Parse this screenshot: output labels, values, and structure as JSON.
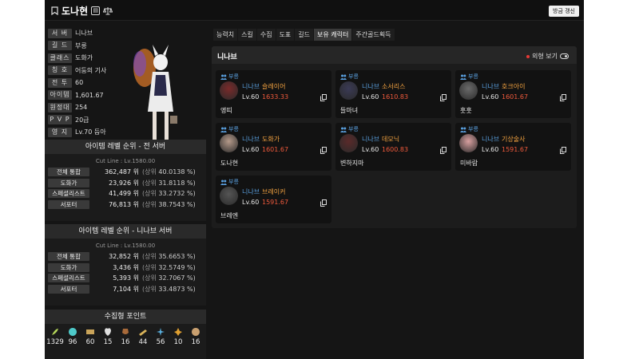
{
  "header": {
    "name": "도나현",
    "refresh_label": "방금 갱신"
  },
  "profile": {
    "rows": [
      {
        "key": "서 버",
        "value": "니나브"
      },
      {
        "key": "길 드",
        "value": "부릉"
      },
      {
        "key": "클래스",
        "value": "도화가"
      },
      {
        "key": "칭 호",
        "value": "어둠의 기사"
      },
      {
        "key": "전 투",
        "value": "60"
      },
      {
        "key": "아이템",
        "value": "1,601.67"
      },
      {
        "key": "원정대",
        "value": "254"
      },
      {
        "key": "P V P",
        "value": "20급"
      },
      {
        "key": "영 지",
        "value": "Lv.70 듬아"
      }
    ]
  },
  "rank_all": {
    "title": "아이템 레벨 순위 - 전 서버",
    "cutline": "Cut Line : Lv.1580.00",
    "rows": [
      {
        "key": "전체 통합",
        "value": "362,487 위",
        "paren_open": "(상위",
        "pct": "40.0138 %)"
      },
      {
        "key": "도화가",
        "value": "23,926 위",
        "paren_open": "(상위",
        "pct": "31.8118 %)"
      },
      {
        "key": "스페셜리스트",
        "value": "41,499 위",
        "paren_open": "(상위",
        "pct": "33.2732 %)"
      },
      {
        "key": "서포터",
        "value": "76,813 위",
        "paren_open": "(상위",
        "pct": "38.7543 %)"
      }
    ]
  },
  "rank_server": {
    "title": "아이템 레벨 순위 - 니나브 서버",
    "cutline": "Cut Line : Lv.1580.00",
    "rows": [
      {
        "key": "전체 통합",
        "value": "32,852 위",
        "paren_open": "(상위",
        "pct": "35.6653 %)"
      },
      {
        "key": "도화가",
        "value": "3,436 위",
        "paren_open": "(상위",
        "pct": "32.5749 %)"
      },
      {
        "key": "스페셜리스트",
        "value": "5,393 위",
        "paren_open": "(상위",
        "pct": "32.7067 %)"
      },
      {
        "key": "서포터",
        "value": "7,104 위",
        "paren_open": "(상위",
        "pct": "33.4873 %)"
      }
    ]
  },
  "collection": {
    "title": "수집형 포인트",
    "items": [
      {
        "icon": "seed-icon",
        "value": "1329",
        "color": "#b5d65a"
      },
      {
        "icon": "island-heart-icon",
        "value": "96",
        "color": "#4ec9c9"
      },
      {
        "icon": "artwork-icon",
        "value": "60",
        "color": "#c9a45a"
      },
      {
        "icon": "giant-heart-icon",
        "value": "15",
        "color": "#e0e0e0"
      },
      {
        "icon": "mokoko-icon",
        "value": "16",
        "color": "#a86a3a"
      },
      {
        "icon": "voyage-icon",
        "value": "44",
        "color": "#d9b35a"
      },
      {
        "icon": "world-tree-leaf-icon",
        "value": "56",
        "color": "#5ab0e0"
      },
      {
        "icon": "ignea-icon",
        "value": "10",
        "color": "#e0a030"
      },
      {
        "icon": "orpheus-star-icon",
        "value": "16",
        "color": "#c9a070"
      }
    ]
  },
  "tabs": [
    {
      "label": "능력치",
      "active": false
    },
    {
      "label": "스킬",
      "active": false
    },
    {
      "label": "수집",
      "active": false
    },
    {
      "label": "도표",
      "active": false
    },
    {
      "label": "길드",
      "active": false
    },
    {
      "label": "보유 캐릭터",
      "active": true
    },
    {
      "label": "주간골드획득",
      "active": false
    }
  ],
  "characters_panel": {
    "server": "니나브",
    "skin_toggle_label": "외형 보기",
    "cards": [
      {
        "role": "부릉",
        "server": "니나브",
        "class": "슬레이어",
        "level": "Lv.60",
        "item_level": "1633.33",
        "name": "앵띠",
        "avatar_color": "#7a2a2a"
      },
      {
        "role": "부릉",
        "server": "니나브",
        "class": "소서리스",
        "level": "Lv.60",
        "item_level": "1610.83",
        "name": "들마녀",
        "avatar_color": "#3a3a55"
      },
      {
        "role": "부릉",
        "server": "니나브",
        "class": "호크아이",
        "level": "Lv.60",
        "item_level": "1601.67",
        "name": "훗훗",
        "avatar_color": "#6a6a6a"
      },
      {
        "role": "부릉",
        "server": "니나브",
        "class": "도화가",
        "level": "Lv.60",
        "item_level": "1601.67",
        "name": "도나현",
        "avatar_color": "#b59a8a"
      },
      {
        "role": "부릉",
        "server": "니나브",
        "class": "데모닉",
        "level": "Lv.60",
        "item_level": "1600.83",
        "name": "변하지마",
        "avatar_color": "#5a2a2a"
      },
      {
        "role": "부릉",
        "server": "니나브",
        "class": "기상술사",
        "level": "Lv.60",
        "item_level": "1591.67",
        "name": "미바람",
        "avatar_color": "#d9a0a0"
      },
      {
        "role": "부릉",
        "server": "니나브",
        "class": "브레이커",
        "level": "Lv.60",
        "item_level": "1591.67",
        "name": "브레엔",
        "avatar_color": "#555555"
      }
    ]
  }
}
